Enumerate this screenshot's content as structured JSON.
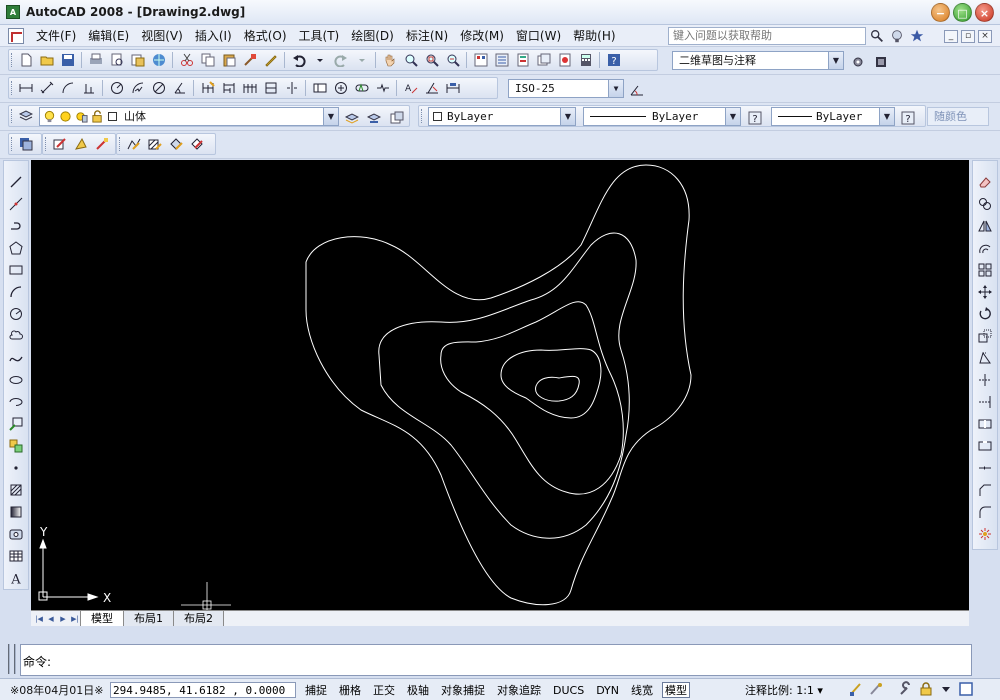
{
  "window": {
    "title": "AutoCAD 2008 - [Drawing2.dwg]",
    "app_icon_label": "A",
    "buttons": {
      "minimize": "−",
      "maximize": "□",
      "close": "×"
    }
  },
  "menubar": {
    "items": [
      "文件(F)",
      "编辑(E)",
      "视图(V)",
      "插入(I)",
      "格式(O)",
      "工具(T)",
      "绘图(D)",
      "标注(N)",
      "修改(M)",
      "窗口(W)",
      "帮助(H)"
    ],
    "help_placeholder": "键入问题以获取帮助",
    "mdi_buttons": [
      "_",
      "▫",
      "×"
    ]
  },
  "toolbars": {
    "workspace": "二维草图与注释",
    "dim_style": "ISO-25",
    "layer": "山体",
    "color": "ByLayer",
    "linetype": "ByLayer",
    "lineweight": "ByLayer",
    "plotstyle": "随颜色"
  },
  "ucs": {
    "x_label": "X",
    "y_label": "Y"
  },
  "layout_tabs": [
    "模型",
    "布局1",
    "布局2"
  ],
  "command": {
    "prompt": "命令:"
  },
  "status": {
    "date": "※08年04月01日※",
    "coords": "294.9485,  41.6182 , 0.0000",
    "toggles": [
      {
        "label": "捕捉",
        "on": false
      },
      {
        "label": "栅格",
        "on": false
      },
      {
        "label": "正交",
        "on": false
      },
      {
        "label": "极轴",
        "on": false
      },
      {
        "label": "对象捕捉",
        "on": false
      },
      {
        "label": "对象追踪",
        "on": false
      },
      {
        "label": "DUCS",
        "on": false
      },
      {
        "label": "DYN",
        "on": false
      },
      {
        "label": "线宽",
        "on": false
      },
      {
        "label": "模型",
        "on": true
      }
    ],
    "annotation_scale": "注释比例: 1:1 ▾"
  },
  "colors": {
    "canvas": "#000000",
    "contour": "#ffffff",
    "chrome": "#dde5f3"
  }
}
